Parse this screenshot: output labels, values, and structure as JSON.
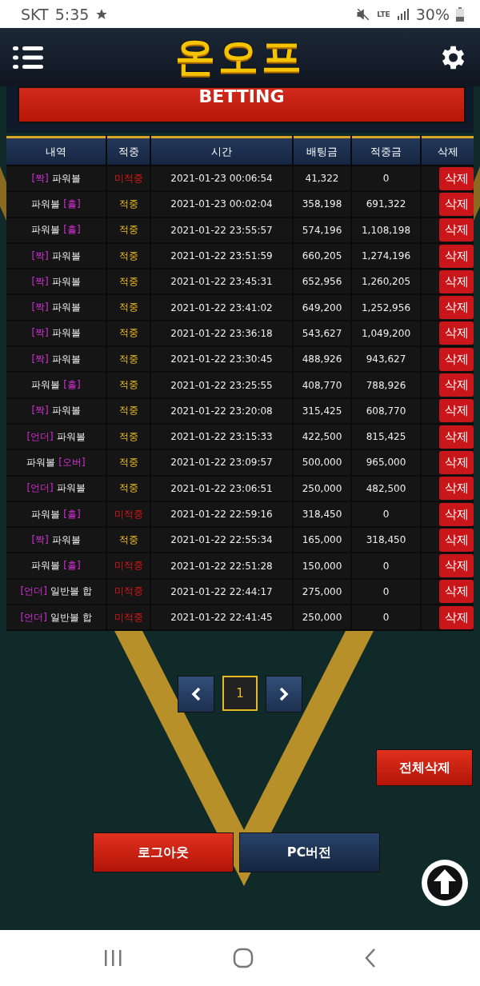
{
  "status_bar": {
    "carrier": "SKT",
    "time": "5:35",
    "network": "LTE",
    "battery": "30%"
  },
  "header": {
    "logo": "온오프"
  },
  "banner": {
    "label": "BETTING"
  },
  "table": {
    "columns": [
      "내역",
      "적중",
      "시간",
      "배팅금",
      "적중금",
      "삭제"
    ],
    "rows": [
      {
        "pick": "[짝]",
        "game": "파워볼",
        "pick_first": true,
        "result": "미적중",
        "hit": false,
        "time": "2021-01-23 00:06:54",
        "bet": "41,322",
        "payout": "0",
        "action": "삭제"
      },
      {
        "pick": "[홀]",
        "game": "파워볼",
        "pick_first": false,
        "result": "적중",
        "hit": true,
        "time": "2021-01-23 00:02:04",
        "bet": "358,198",
        "payout": "691,322",
        "action": "삭제"
      },
      {
        "pick": "[홀]",
        "game": "파워볼",
        "pick_first": false,
        "result": "적중",
        "hit": true,
        "time": "2021-01-22 23:55:57",
        "bet": "574,196",
        "payout": "1,108,198",
        "action": "삭제"
      },
      {
        "pick": "[짝]",
        "game": "파워볼",
        "pick_first": true,
        "result": "적중",
        "hit": true,
        "time": "2021-01-22 23:51:59",
        "bet": "660,205",
        "payout": "1,274,196",
        "action": "삭제"
      },
      {
        "pick": "[짝]",
        "game": "파워볼",
        "pick_first": true,
        "result": "적중",
        "hit": true,
        "time": "2021-01-22 23:45:31",
        "bet": "652,956",
        "payout": "1,260,205",
        "action": "삭제"
      },
      {
        "pick": "[짝]",
        "game": "파워볼",
        "pick_first": true,
        "result": "적중",
        "hit": true,
        "time": "2021-01-22 23:41:02",
        "bet": "649,200",
        "payout": "1,252,956",
        "action": "삭제"
      },
      {
        "pick": "[짝]",
        "game": "파워볼",
        "pick_first": true,
        "result": "적중",
        "hit": true,
        "time": "2021-01-22 23:36:18",
        "bet": "543,627",
        "payout": "1,049,200",
        "action": "삭제"
      },
      {
        "pick": "[짝]",
        "game": "파워볼",
        "pick_first": true,
        "result": "적중",
        "hit": true,
        "time": "2021-01-22 23:30:45",
        "bet": "488,926",
        "payout": "943,627",
        "action": "삭제"
      },
      {
        "pick": "[홀]",
        "game": "파워볼",
        "pick_first": false,
        "result": "적중",
        "hit": true,
        "time": "2021-01-22 23:25:55",
        "bet": "408,770",
        "payout": "788,926",
        "action": "삭제"
      },
      {
        "pick": "[짝]",
        "game": "파워볼",
        "pick_first": true,
        "result": "적중",
        "hit": true,
        "time": "2021-01-22 23:20:08",
        "bet": "315,425",
        "payout": "608,770",
        "action": "삭제"
      },
      {
        "pick": "[언더]",
        "game": "파워볼",
        "pick_first": true,
        "result": "적중",
        "hit": true,
        "time": "2021-01-22 23:15:33",
        "bet": "422,500",
        "payout": "815,425",
        "action": "삭제"
      },
      {
        "pick": "[오버]",
        "game": "파워볼",
        "pick_first": false,
        "result": "적중",
        "hit": true,
        "time": "2021-01-22 23:09:57",
        "bet": "500,000",
        "payout": "965,000",
        "action": "삭제"
      },
      {
        "pick": "[언더]",
        "game": "파워볼",
        "pick_first": true,
        "result": "적중",
        "hit": true,
        "time": "2021-01-22 23:06:51",
        "bet": "250,000",
        "payout": "482,500",
        "action": "삭제"
      },
      {
        "pick": "[홀]",
        "game": "파워볼",
        "pick_first": false,
        "result": "미적중",
        "hit": false,
        "time": "2021-01-22 22:59:16",
        "bet": "318,450",
        "payout": "0",
        "action": "삭제"
      },
      {
        "pick": "[짝]",
        "game": "파워볼",
        "pick_first": true,
        "result": "적중",
        "hit": true,
        "time": "2021-01-22 22:55:34",
        "bet": "165,000",
        "payout": "318,450",
        "action": "삭제"
      },
      {
        "pick": "[홀]",
        "game": "파워볼",
        "pick_first": false,
        "result": "미적중",
        "hit": false,
        "time": "2021-01-22 22:51:28",
        "bet": "150,000",
        "payout": "0",
        "action": "삭제"
      },
      {
        "pick": "[언더]",
        "game": "일반볼 합",
        "pick_first": true,
        "result": "미적중",
        "hit": false,
        "time": "2021-01-22 22:44:17",
        "bet": "275,000",
        "payout": "0",
        "action": "삭제"
      },
      {
        "pick": "[언더]",
        "game": "일반볼 합",
        "pick_first": true,
        "result": "미적중",
        "hit": false,
        "time": "2021-01-22 22:41:45",
        "bet": "250,000",
        "payout": "0",
        "action": "삭제"
      }
    ]
  },
  "pagination": {
    "pages": [
      {
        "label": "1",
        "selected": true
      }
    ]
  },
  "delete_all": "전체삭제",
  "buttons": [
    {
      "label": "로그아웃",
      "kind": "danger"
    },
    {
      "label": "PC버전",
      "kind": "primary"
    }
  ]
}
